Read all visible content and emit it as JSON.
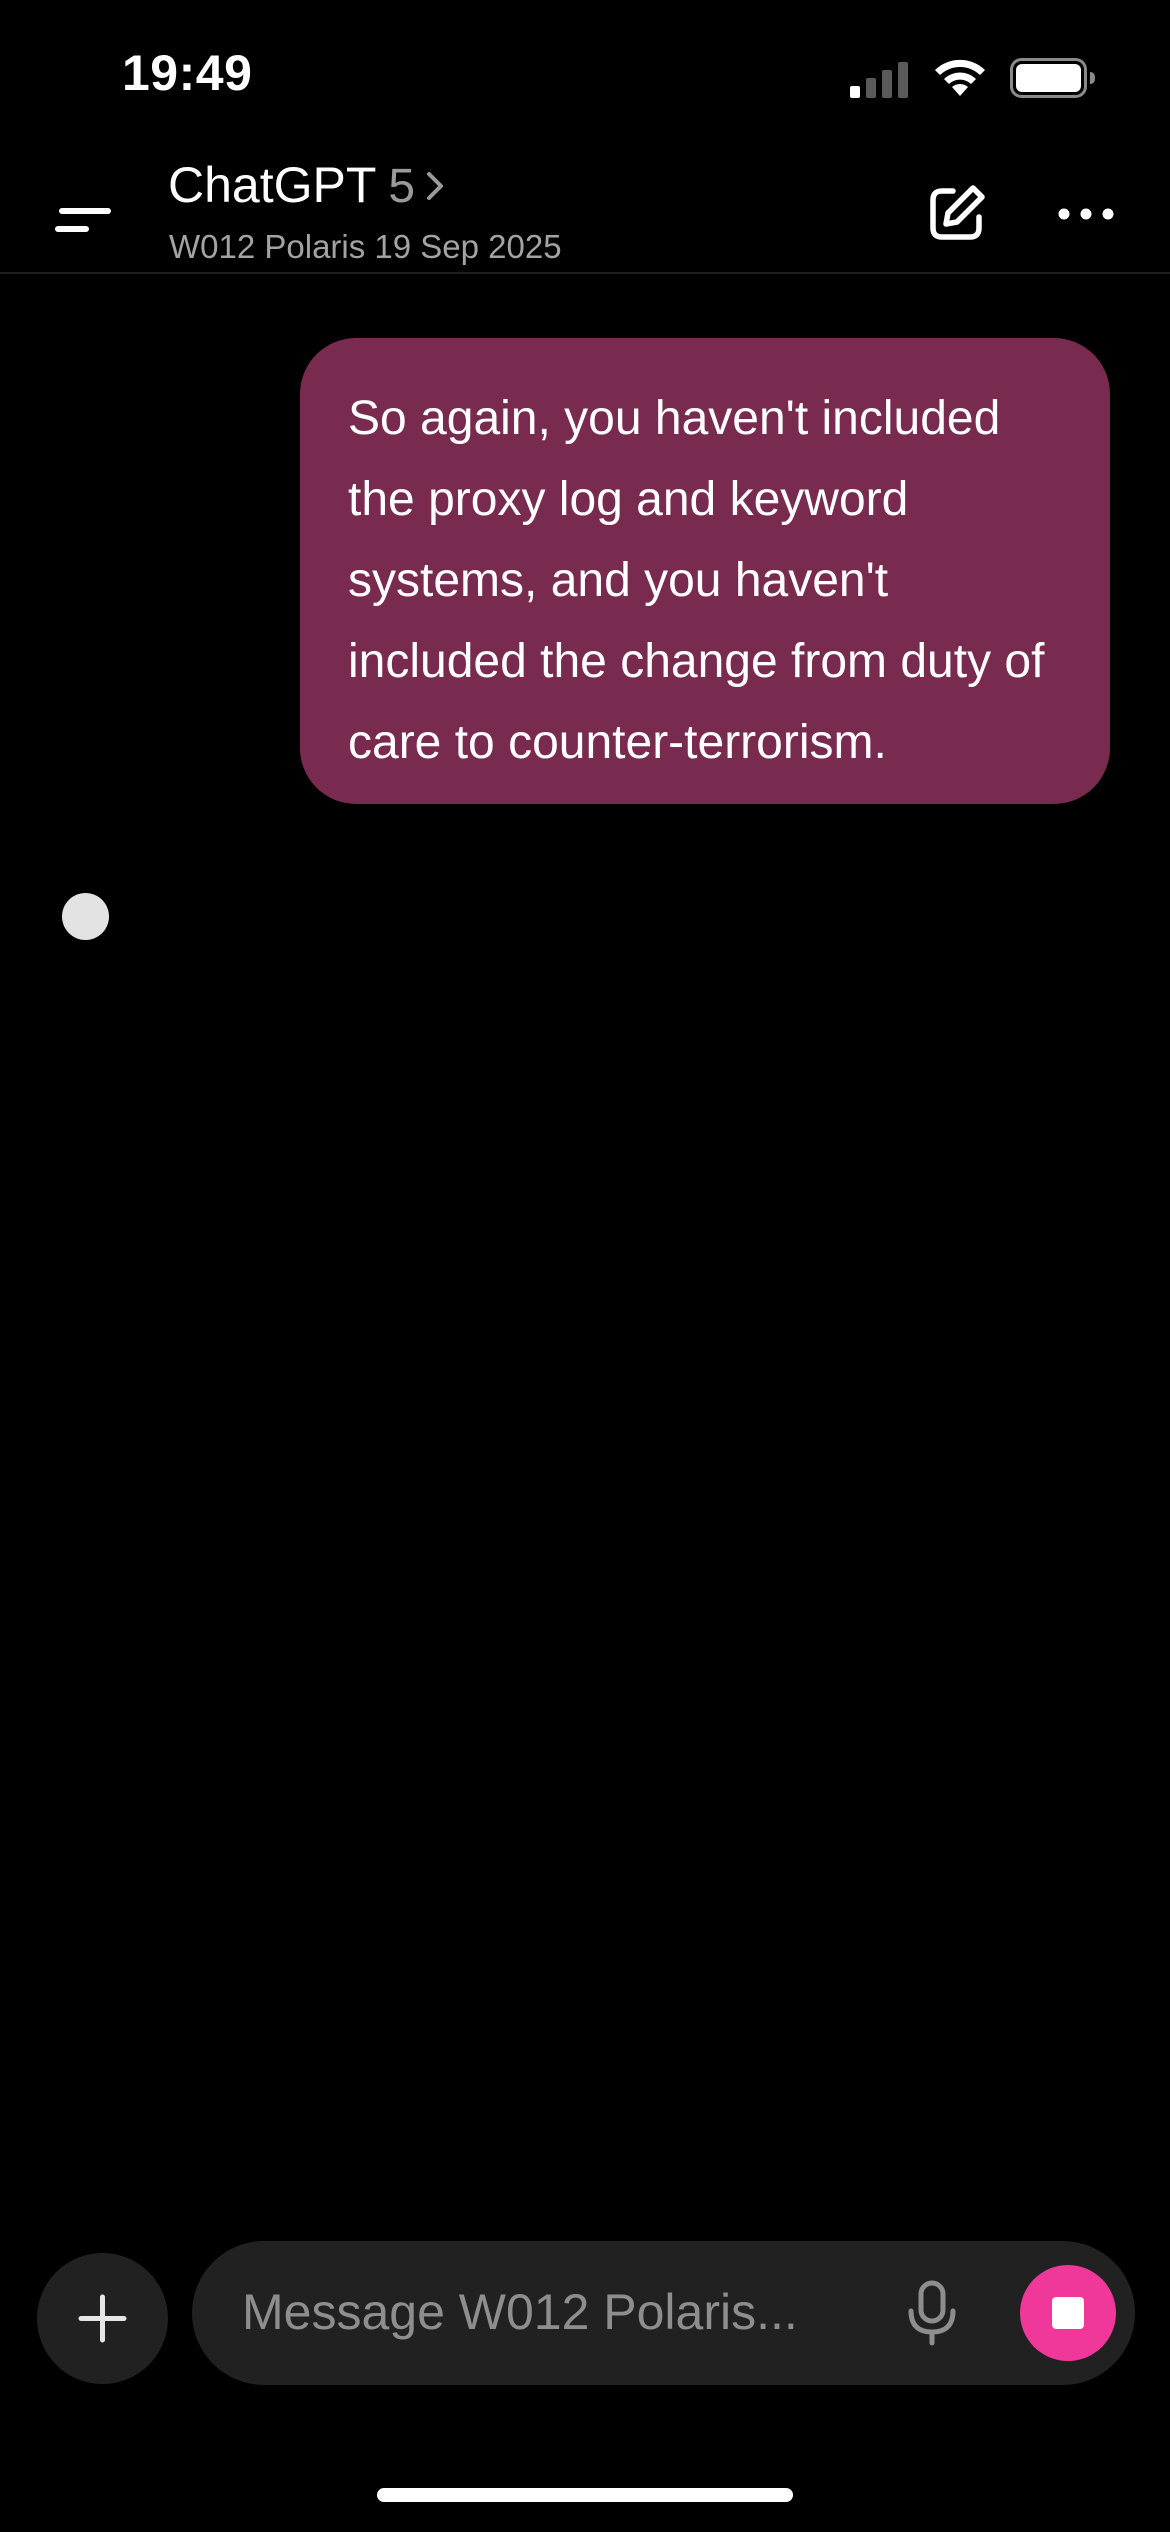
{
  "status_bar": {
    "time": "19:49",
    "icons": [
      "cellular-signal-icon",
      "wifi-icon",
      "battery-icon"
    ]
  },
  "header": {
    "title": "ChatGPT",
    "model_version": "5",
    "subtitle": "W012 Polaris 19 Sep 2025",
    "icons": [
      "menu-icon",
      "chevron-right-icon",
      "new-chat-icon",
      "more-icon"
    ]
  },
  "conversation": {
    "messages": [
      {
        "role": "user",
        "text": "So again, you haven't included the proxy log and keyword systems, and you haven't included the change from duty of care to counter-terrorism."
      }
    ],
    "assistant_state": "thinking"
  },
  "composer": {
    "placeholder": "Message W012 Polaris...",
    "icons": [
      "plus-icon",
      "microphone-icon",
      "stop-icon"
    ]
  },
  "colors": {
    "background": "#000000",
    "user_bubble": "#782b4f",
    "stop_button": "#f0379a",
    "input_background": "#212121"
  }
}
